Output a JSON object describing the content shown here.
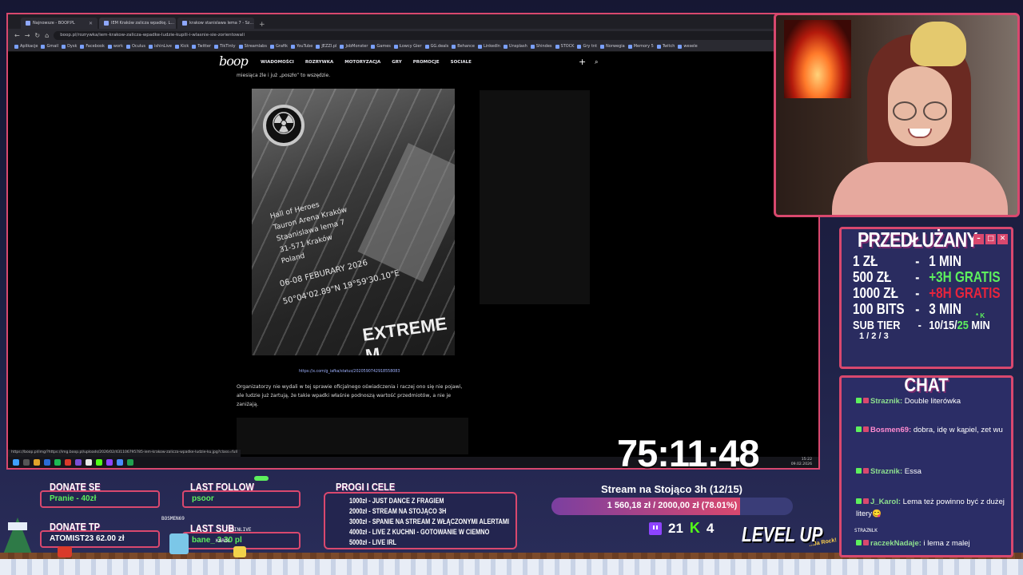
{
  "browser": {
    "tabs": [
      {
        "label": "Najnowsze - BOOP.PL",
        "active": false
      },
      {
        "label": "IEM Kraków zalicza wpadkę. L...",
        "active": true
      },
      {
        "label": "krakow stanislawa lema 7 - Sz...",
        "active": false
      }
    ],
    "new_tab": "+",
    "url": "boop.pl/rozrywka/iem-krakow-zalicza-wpadke-ludzie-kupili-i-wlasnie-sie-zorientowali",
    "bookmarks": [
      "Aplikacje",
      "Gmail",
      "Dysk",
      "Facebook",
      "work",
      "Oculus",
      "ishinLive",
      "Kick",
      "Twitter",
      "TikTinty",
      "Streamlabs",
      "Grafik",
      "YouTube",
      "JEZZI.pl",
      "JobMonster",
      "Games",
      "Łowcy Gier",
      "GG.deals",
      "Behance",
      "LinkedIn",
      "Unsplash",
      "Shindes",
      "STOCK",
      "Gry tnt",
      "Norwegia",
      "Memory 5",
      "Twitch",
      "wesele"
    ],
    "status_url": "https://boop.pl/img/?https://img.boop.pl/uploads/2026/02/431106795785-iem-krakow-zalicza-wpadke-ludzie-ku.jpg?class=full",
    "clock_time": "15:22",
    "clock_date": "09.02.2026"
  },
  "site": {
    "logo": "boop",
    "menu": [
      "WIADOMOŚCI",
      "ROZRYWKA",
      "MOTORYZACJA",
      "GRY",
      "PROMOCJE",
      "SOCIALE"
    ],
    "lead_text": "miesiąca źle i już „poszło” to wszędzie.",
    "photo_lines": [
      "Hall of Heroes",
      "Tauron Arena Kraków",
      "Staanislawa lema 7",
      "31-571 Kraków",
      "Poland",
      "06-08 FEBURARY 2026",
      "50°04'02.89\"N 19°59'30.10\"E"
    ],
    "photo_brand": "EXTREME M",
    "caption": "https://x.com/g_iafka/status/2020590742918558083",
    "paragraph": "Organizatorzy nie wydali w tej sprawie oficjalnego oświadczenia i raczej ono się nie pojawi, ale ludzie już żartują, że takie wpadki właśnie podnoszą wartość przedmiotów, a nie je zaniżają."
  },
  "timer": "75:11:48",
  "extension": {
    "title": "PRZEDŁUŻANY",
    "rows": [
      {
        "amount": "1 ZŁ",
        "value": "1 MIN",
        "style": "white"
      },
      {
        "amount": "500 ZŁ",
        "value": "+3H GRATIS",
        "style": "green"
      },
      {
        "amount": "1000 ZŁ",
        "value": "+8H GRATIS",
        "style": "red"
      },
      {
        "amount": "100 BITS",
        "value": "3 MIN",
        "style": "white"
      }
    ],
    "sub_label": "SUB TIER",
    "sub_tiers": "1 / 2 / 3",
    "sub_value_a": "10/15/",
    "sub_value_b": "25",
    "sub_value_c": " MIN",
    "sub_k": "* K"
  },
  "chat": {
    "title": "CHAT",
    "messages": [
      {
        "user": "Straznik:",
        "text": "Double literówka"
      },
      {
        "user": "Bosmen69:",
        "text": "dobra, idę w kąpiel, zet wu"
      },
      {
        "user": "Straznik:",
        "text": "Essa"
      },
      {
        "user": "J_Karol:",
        "text": "Lema też powinno być z dużej litery😋"
      },
      {
        "user": "raczekNadaje:",
        "text": "i lema z malej"
      }
    ],
    "strip_label": "STRAZNLK"
  },
  "widgets": {
    "donate_se_label": "DONATE SE",
    "donate_se_value": "Pranie - 40zł",
    "donate_tp_label": "DONATE TP",
    "donate_tp_value": "ATOMIST23 62.00 zł",
    "last_follow_label": "LAST FOLLOW",
    "last_follow_value": "psoor",
    "last_sub_label": "LAST SUB",
    "last_sub_value": "bane_ 3 30 pl",
    "sprite_labels": [
      "BOSMEN69",
      "ISHINLIVE",
      "KAROL"
    ],
    "goals_title": "PROGI I CELE",
    "goals": [
      "1000zł - JUST DANCE Z FRAGIEM",
      "2000zł - STREAM NA STOJĄCO 3H",
      "3000zł - SPANIE NA STREAM Z WŁĄCZONYMI ALERTAMI",
      "4000zł - LIVE Z KUCHNI - GOTOWANIE W CIEMNO",
      "5000zł - LIVE IRL"
    ],
    "subgoal_title": "Stream na Stojąco 3h (12/15)",
    "subgoal_progress_text": "1 560,18 zł / 2000,00 zł (78.01%)",
    "subgoal_fraction": 0.7801,
    "twitch_count": "21",
    "kick_count": "4",
    "levelup": "LEVEL UP",
    "levelup_sub": "...Ja Rock!"
  },
  "colors": {
    "accent": "#d9486e",
    "green": "#5df05d",
    "red": "#e8243c",
    "panel": "#2b2d66"
  }
}
